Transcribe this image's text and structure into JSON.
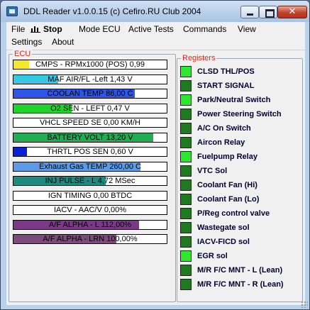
{
  "window": {
    "title": "DDL Reader v1.0.0.15 (c)  Cefiro.RU Club 2004",
    "close_glyph": "✕"
  },
  "menu": {
    "row1": [
      "File",
      "Stop",
      "Mode ECU",
      "Active Tests",
      "Commands",
      "View"
    ],
    "row2": [
      "Settings",
      "About"
    ]
  },
  "ecu": {
    "label": "ECU",
    "gauges": [
      {
        "label": "CMPS - RPMx1000 (POS) 0,99",
        "fill": 0.1,
        "color": "#f2e72a"
      },
      {
        "label": "MAF AIR/FL -Left 1,43 V",
        "fill": 0.29,
        "color": "#35c8e3"
      },
      {
        "label": "COOLAN TEMP 86,00 C",
        "fill": 0.79,
        "color": "#2d55e6"
      },
      {
        "label": "O2 SEN - LEFT 0,47 V",
        "fill": 0.38,
        "color": "#1ed428"
      },
      {
        "label": "VHCL SPEED SE 0,00 KM/H",
        "fill": 0.0,
        "color": "#000000"
      },
      {
        "label": "BATTERY VOLT 13,20 V",
        "fill": 0.91,
        "color": "#22ad55"
      },
      {
        "label": "THRTL POS SEN 0,60 V",
        "fill": 0.09,
        "color": "#0b1fd4"
      },
      {
        "label": "Exhaust Gas TEMP 260,00 C",
        "fill": 0.83,
        "color": "#5c9be8"
      },
      {
        "label": "INJ PULSE - L 4,72 MSec",
        "fill": 0.6,
        "color": "#1f8a80"
      },
      {
        "label": "IGN TIMING 0,00 BTDC",
        "fill": 0.0,
        "color": "#000000"
      },
      {
        "label": "IACV - AAC/V 0,00%",
        "fill": 0.0,
        "color": "#000000"
      },
      {
        "label": "A/F ALPHA - L 112,00%",
        "fill": 0.82,
        "color": "#7a3a88"
      },
      {
        "label": "A/F ALPHA - LRN 100,00%",
        "fill": 0.67,
        "color": "#7b4b7a"
      }
    ]
  },
  "registers": {
    "label": "Registers",
    "items": [
      {
        "label": "CLSD THL/POS",
        "on": true
      },
      {
        "label": "START SIGNAL",
        "on": false
      },
      {
        "label": "Park/Neutral Switch",
        "on": true
      },
      {
        "label": "Power Steering Switch",
        "on": false
      },
      {
        "label": "A/C On Switch",
        "on": false
      },
      {
        "label": "Aircon Relay",
        "on": false
      },
      {
        "label": "Fuelpump Relay",
        "on": true
      },
      {
        "label": "VTC Sol",
        "on": false
      },
      {
        "label": "Coolant Fan (Hi)",
        "on": false
      },
      {
        "label": "Coolant Fan (Lo)",
        "on": false
      },
      {
        "label": "P/Reg control valve",
        "on": false
      },
      {
        "label": "Wastegate sol",
        "on": false
      },
      {
        "label": "IACV-FICD sol",
        "on": false
      },
      {
        "label": "EGR sol",
        "on": true
      },
      {
        "label": "M/R F/C MNT - L (Lean)",
        "on": false
      },
      {
        "label": "M/R F/C MNT - R (Lean)",
        "on": false
      }
    ]
  }
}
